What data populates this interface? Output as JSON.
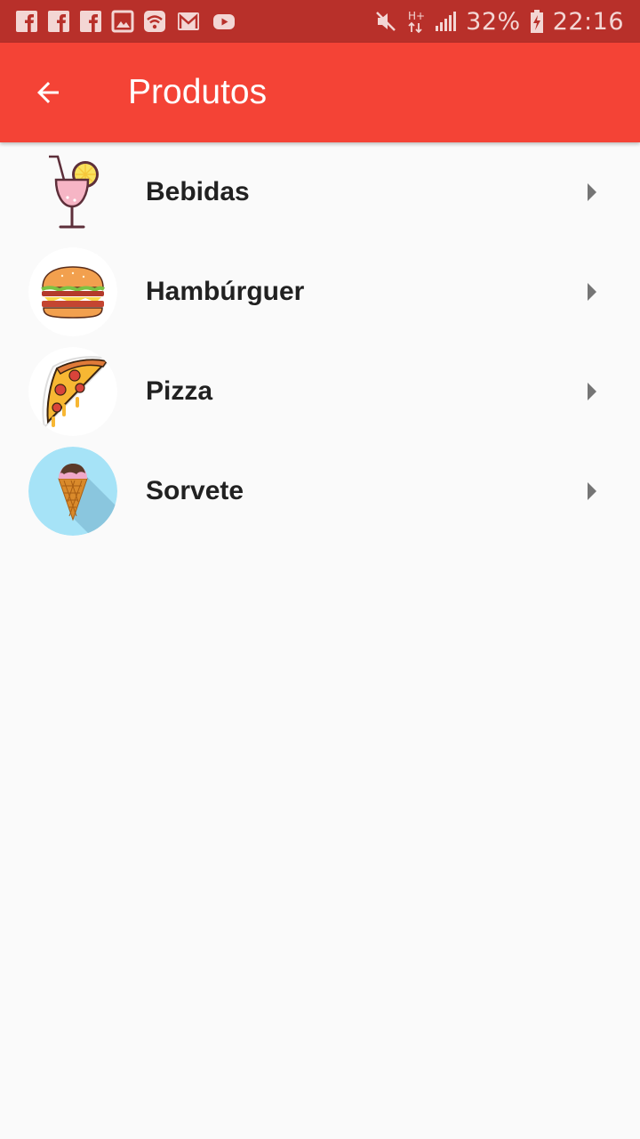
{
  "status_bar": {
    "battery": "32%",
    "time": "22:16",
    "icons": [
      "facebook-icon",
      "facebook-icon",
      "facebook-icon",
      "image-icon",
      "wifi-icon",
      "gmail-icon",
      "youtube-icon",
      "mute-icon",
      "network-hplus-icon",
      "signal-icon",
      "battery-charging-icon"
    ]
  },
  "app_bar": {
    "title": "Produtos",
    "back_icon": "arrow-back-icon"
  },
  "products": [
    {
      "label": "Bebidas",
      "icon": "drink-icon"
    },
    {
      "label": "Hambúrguer",
      "icon": "hamburger-icon"
    },
    {
      "label": "Pizza",
      "icon": "pizza-icon"
    },
    {
      "label": "Sorvete",
      "icon": "ice-cream-icon"
    }
  ],
  "colors": {
    "status_bar": "#b8302a",
    "app_bar": "#f44336",
    "background": "#fafafa",
    "text": "#212121"
  }
}
